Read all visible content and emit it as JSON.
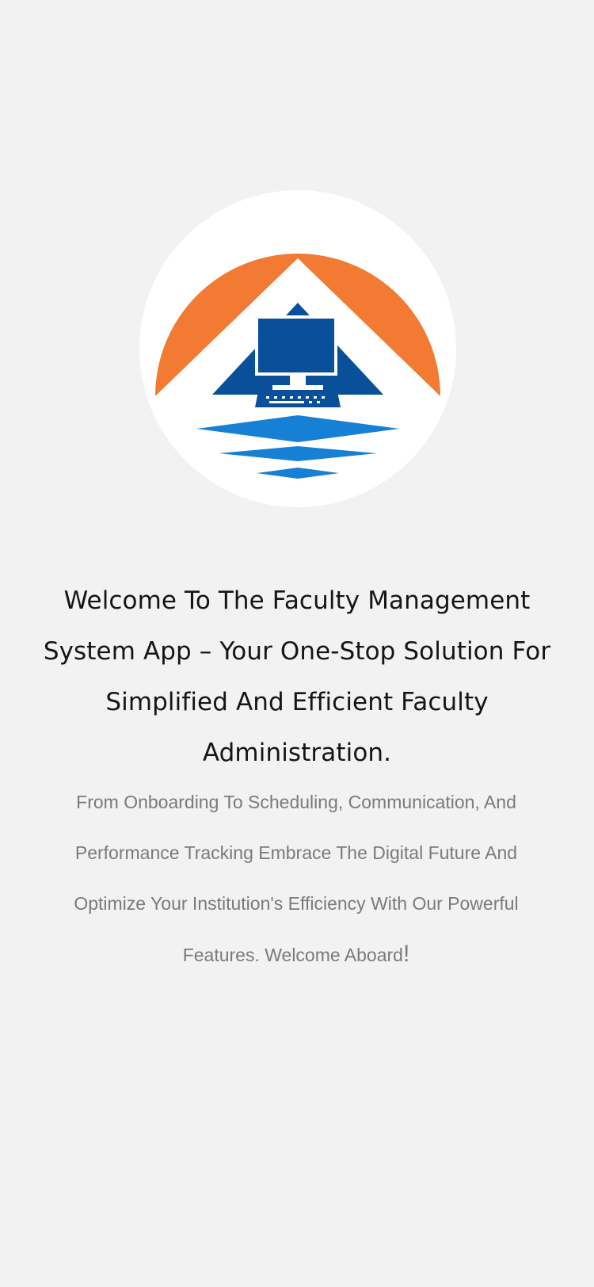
{
  "logo": {
    "name": "faculty-management-logo",
    "colors": {
      "orange": "#f27a32",
      "navy": "#0a4f9a",
      "blue": "#1580d4",
      "white": "#ffffff"
    }
  },
  "welcome": {
    "title": "Welcome To The Faculty Management System App – Your One-Stop Solution For Simplified And Efficient Faculty Administration.",
    "description": "From Onboarding To Scheduling, Communication, And Performance Tracking Embrace The Digital Future And Optimize Your Institution's Efficiency With Our Powerful Features. Welcome Aboard",
    "description_end": "!"
  }
}
